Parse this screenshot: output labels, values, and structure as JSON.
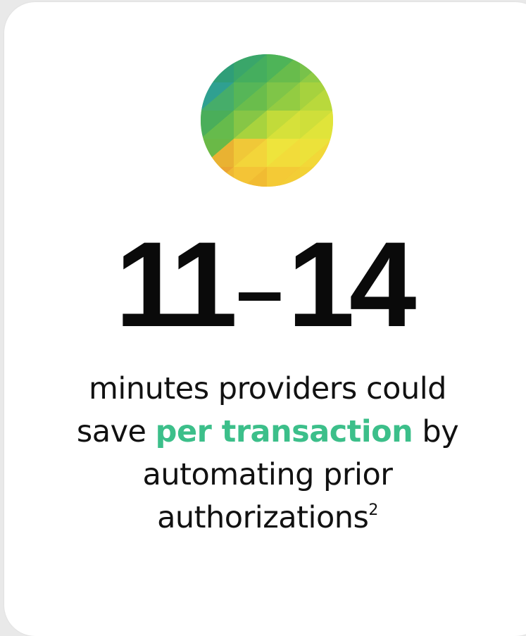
{
  "stat": {
    "start": "11",
    "dash": "–",
    "end": "14"
  },
  "description": {
    "line1": "minutes providers could",
    "line2_prefix": "save ",
    "highlight": "per transaction",
    "line2_suffix": " by",
    "line3": "automating prior",
    "line4": "authorizations",
    "footnote": "2"
  },
  "colors": {
    "highlight": "#3cbf8a",
    "stat_text": "#0a0a0a",
    "card_bg": "#ffffff",
    "page_bg": "#e9e9e9"
  },
  "icons": {
    "logo": "geometric-triangle-gradient-circle-icon"
  }
}
